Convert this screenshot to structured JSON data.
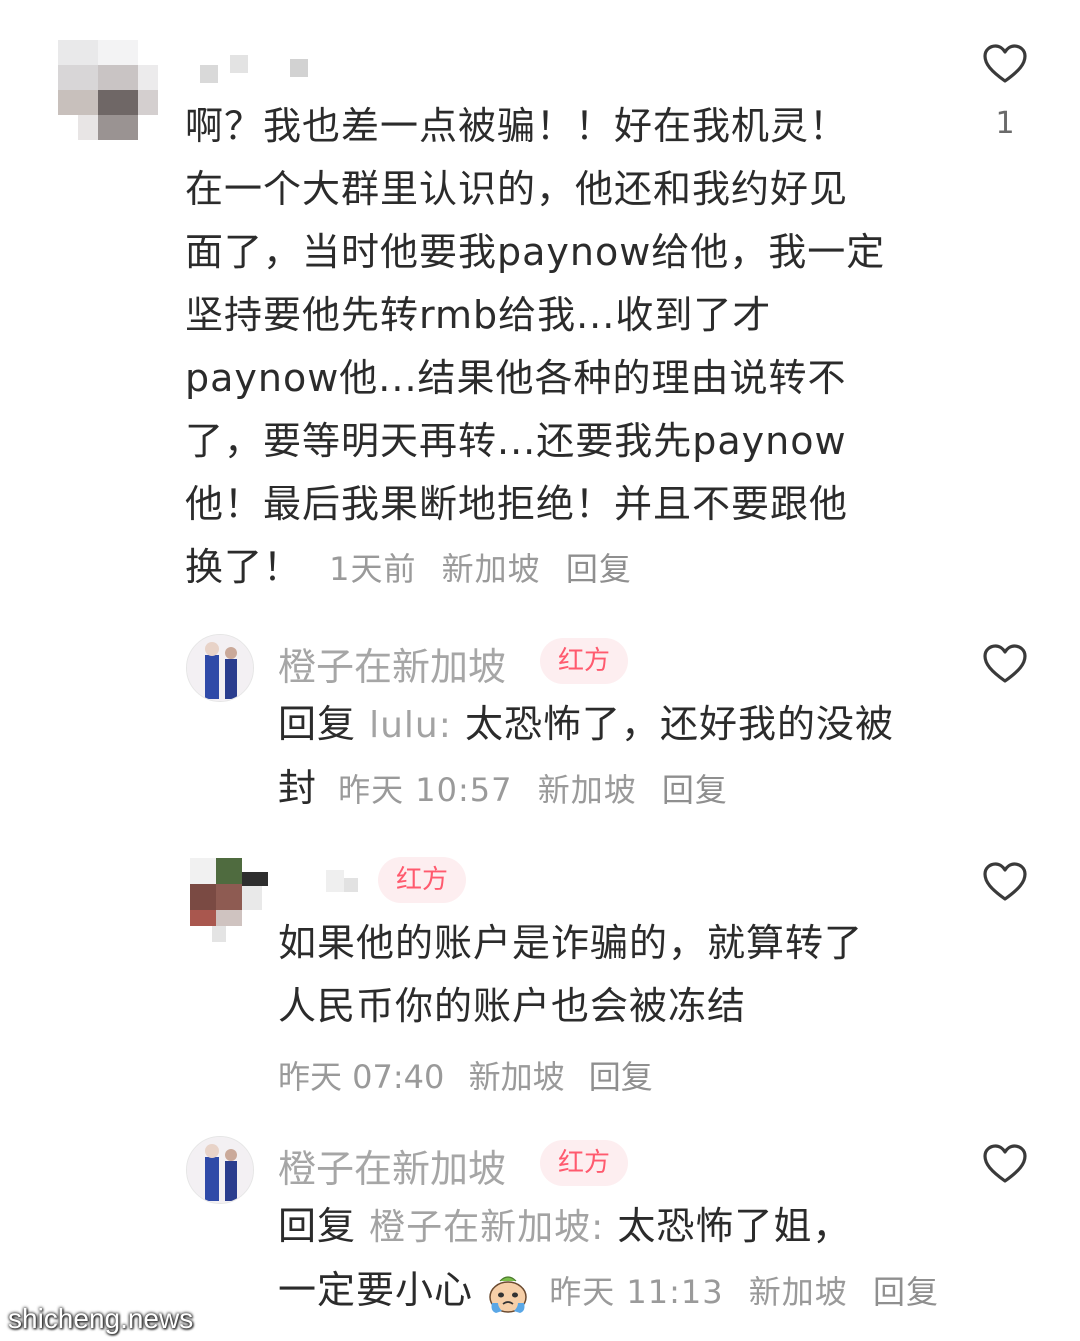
{
  "comments": [
    {
      "text_lines": [
        "啊？我也差一点被骗！！好在我机灵！",
        "在一个大群里认识的，他还和我约好见",
        "面了，当时他要我paynow给他，我一定",
        "坚持要他先转rmb给我...收到了才",
        "paynow他...结果他各种的理由说转不",
        "了，要等明天再转...还要我先paynow",
        "他！最后我果断地拒绝！并且不要跟他"
      ],
      "last_line": "换了！",
      "time": "1天前",
      "location": "新加坡",
      "reply_label": "回复",
      "like_count": "1"
    },
    {
      "username": "橙子在新加坡",
      "badge": "红方",
      "reply_prefix": "回复",
      "reply_to": "lulu:",
      "line1": "太恐怖了，还好我的没被",
      "line2": "封",
      "time": "昨天 10:57",
      "location": "新加坡",
      "reply_label": "回复"
    },
    {
      "badge": "红方",
      "line1": "如果他的账户是诈骗的，就算转了",
      "line2": "人民币你的账户也会被冻结",
      "time": "昨天 07:40",
      "location": "新加坡",
      "reply_label": "回复"
    },
    {
      "username": "橙子在新加坡",
      "badge": "红方",
      "reply_prefix": "回复",
      "reply_to": "橙子在新加坡:",
      "line1": "太恐怖了姐，",
      "line2": "一定要小心",
      "emoji": "crying-face-emoji",
      "time": "昨天 11:13",
      "location": "新加坡",
      "reply_label": "回复"
    }
  ],
  "watermark": "shicheng.news",
  "colors": {
    "badge_bg": "#fdeef0",
    "badge_text": "#ff5a6e",
    "meta_text": "#9a9a9a"
  }
}
